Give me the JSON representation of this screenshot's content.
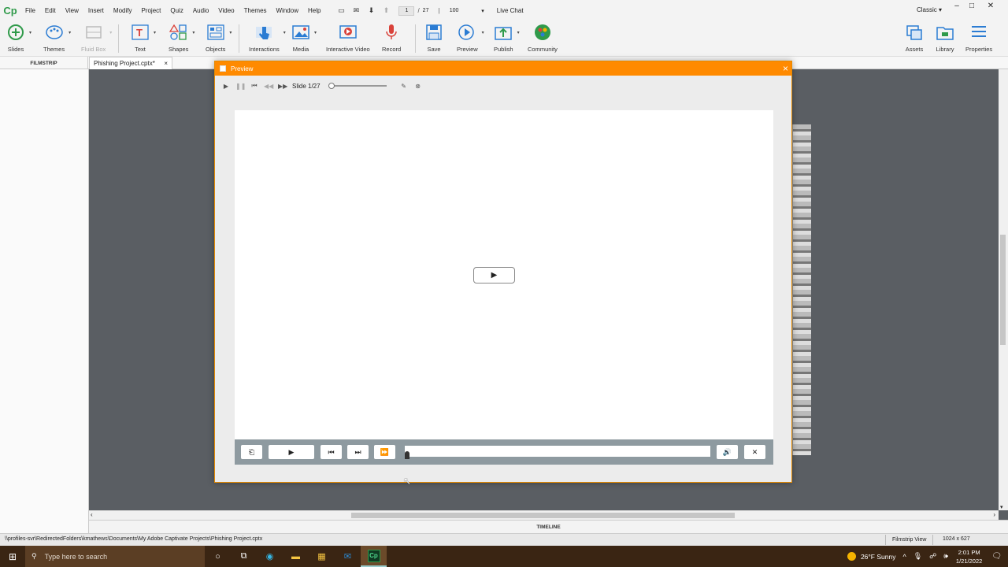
{
  "menubar": {
    "logo": "Cp",
    "items": [
      "File",
      "Edit",
      "View",
      "Insert",
      "Modify",
      "Project",
      "Quiz",
      "Audio",
      "Video",
      "Themes",
      "Window",
      "Help"
    ],
    "current_slide": "1",
    "total_slides": "27",
    "zoom": "100",
    "live_chat": "Live Chat",
    "workspace": "Classic"
  },
  "toolbar": {
    "slides": "Slides",
    "themes": "Themes",
    "fluid_box": "Fluid Box",
    "text": "Text",
    "shapes": "Shapes",
    "objects": "Objects",
    "interactions": "Interactions",
    "media": "Media",
    "interactive_video": "Interactive Video",
    "record": "Record",
    "save": "Save",
    "preview": "Preview",
    "publish": "Publish",
    "community": "Community",
    "assets": "Assets",
    "library": "Library",
    "properties": "Properties"
  },
  "subbar": {
    "filmstrip_label": "FILMSTRIP",
    "doc_tab": "Phishing Project.cptx*"
  },
  "preview": {
    "title": "Preview",
    "slide_label": "Slide 1/27"
  },
  "timeline_label": "TIMELINE",
  "statusbar": {
    "path": "\\\\profiles-svr\\RedirectedFolders\\kmathews\\Documents\\My Adobe Captivate Projects\\Phishing Project.cptx",
    "view": "Filmstrip View",
    "dims": "1024 x 627"
  },
  "taskbar": {
    "search_placeholder": "Type here to search",
    "weather": "26°F  Sunny",
    "time": "2:01 PM",
    "date": "1/21/2022"
  },
  "colors": {
    "accent_orange": "#ff8a00",
    "captivate_green": "#2f9a4a"
  }
}
